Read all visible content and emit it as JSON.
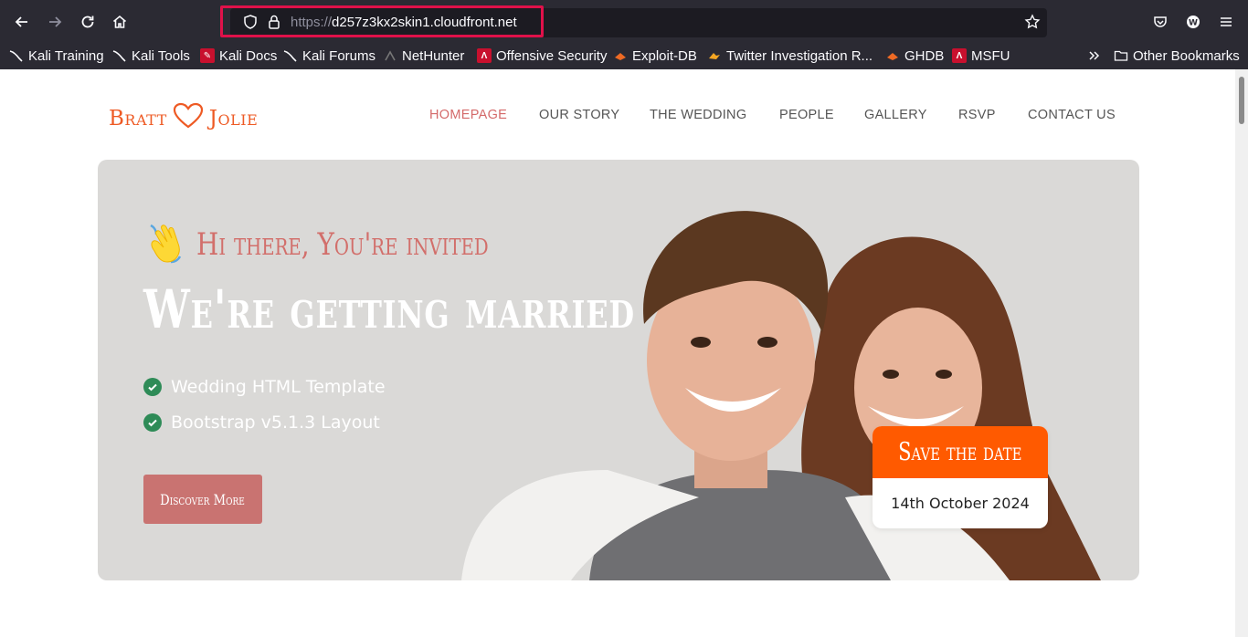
{
  "browser": {
    "url_scheme": "https://",
    "url_host": "d257z3kx2skin1.cloudfront.net",
    "bookmarks": [
      {
        "label": "Kali Training",
        "icon": "kali-dragon-icon"
      },
      {
        "label": "Kali Tools",
        "icon": "kali-dragon-icon"
      },
      {
        "label": "Kali Docs",
        "icon": "kali-docs-icon"
      },
      {
        "label": "Kali Forums",
        "icon": "kali-dragon-icon"
      },
      {
        "label": "NetHunter",
        "icon": "nethunter-icon"
      },
      {
        "label": "Offensive Security",
        "icon": "offsec-icon"
      },
      {
        "label": "Exploit-DB",
        "icon": "exploit-db-icon"
      },
      {
        "label": "Twitter Investigation R...",
        "icon": "twitter-investigation-icon"
      },
      {
        "label": "GHDB",
        "icon": "ghdb-icon"
      },
      {
        "label": "MSFU",
        "icon": "offsec-icon"
      }
    ],
    "other_bookmarks": "Other Bookmarks"
  },
  "site": {
    "logo_left": "Bratt",
    "logo_right": "Jolie",
    "nav": [
      "HOMEPAGE",
      "OUR STORY",
      "THE WEDDING",
      "PEOPLE",
      "GALLERY",
      "RSVP",
      "CONTACT US"
    ],
    "active_nav": "HOMEPAGE"
  },
  "hero": {
    "greeting": "Hi there, You're invited",
    "headline": "We're getting married",
    "features": [
      "Wedding HTML Template",
      "Bootstrap v5.1.3 Layout"
    ],
    "cta": "Discover More",
    "save_title": "Save the date",
    "save_date": "14th October 2024"
  },
  "colors": {
    "accent": "#d26f6b",
    "brand_orange": "#ff5a00",
    "check_green": "#2e8b57",
    "hero_bg": "#dad9d7"
  }
}
